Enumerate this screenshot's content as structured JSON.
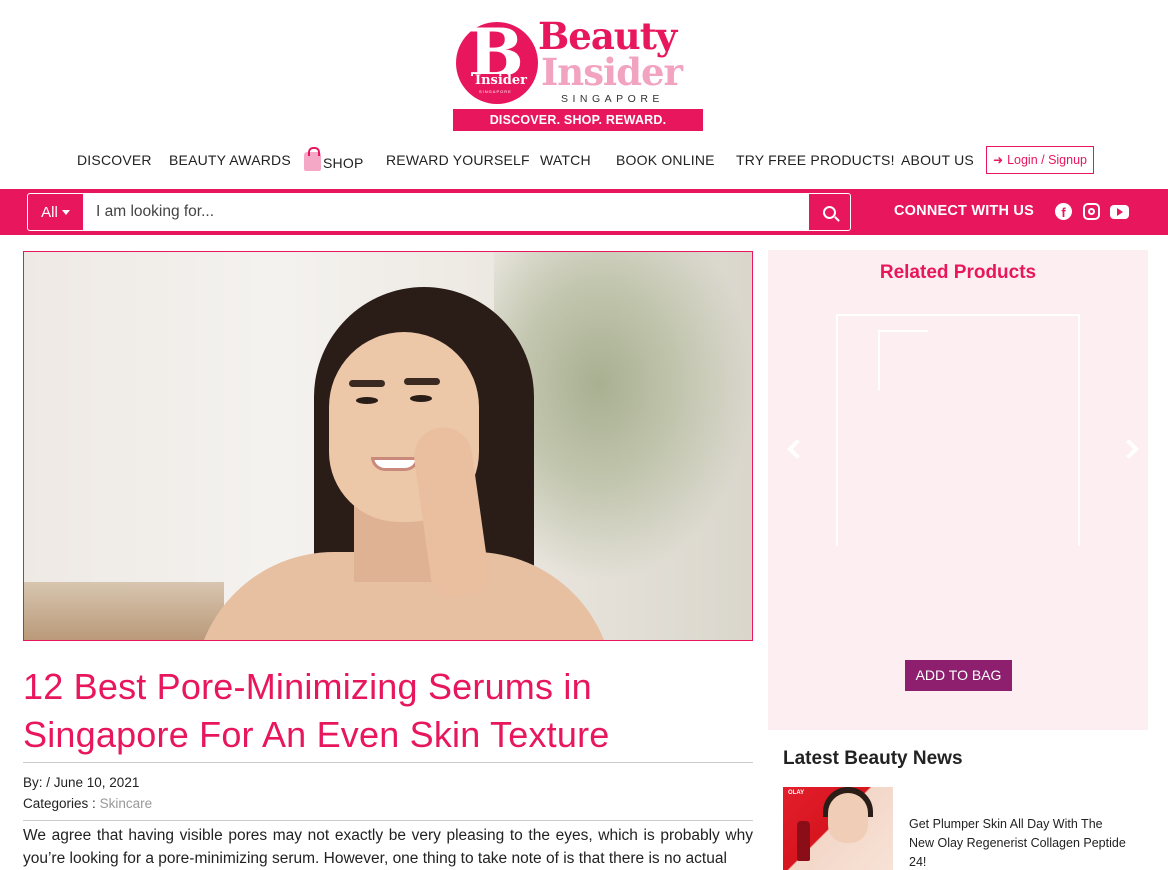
{
  "logo": {
    "letter": "B",
    "badge_word": "Insider",
    "badge_sub": "SINGAPORE",
    "word1": "Beauty",
    "word2": "Insider",
    "region": "SINGAPORE",
    "tagline": "DISCOVER. SHOP. REWARD."
  },
  "nav": {
    "items": [
      {
        "label": "DISCOVER"
      },
      {
        "label": "BEAUTY AWARDS"
      },
      {
        "label": "SHOP"
      },
      {
        "label": "REWARD YOURSELF"
      },
      {
        "label": "WATCH"
      },
      {
        "label": "BOOK ONLINE"
      },
      {
        "label": "TRY FREE PRODUCTS!"
      },
      {
        "label": "ABOUT US"
      }
    ],
    "login_label": "Login / Signup"
  },
  "search": {
    "category": "All",
    "placeholder": "I am looking for...",
    "connect_label": "CONNECT WITH US"
  },
  "icons": {
    "shop": "shopping-bag-icon",
    "login": "sign-in-icon",
    "dropdown": "caret-down-icon",
    "search": "search-icon",
    "facebook": "facebook-icon",
    "instagram": "instagram-icon",
    "youtube": "youtube-icon",
    "carousel_prev": "chevron-left-icon",
    "carousel_next": "chevron-right-icon"
  },
  "colors": {
    "brand": "#e8175d",
    "brand_light": "#f1a3bf",
    "add_button": "#8d1f6e",
    "related_bg": "#fdeef2"
  },
  "article": {
    "title": "12 Best Pore-Minimizing Serums in Singapore For An Even Skin Texture",
    "byline": "By: / June 10, 2021",
    "categories_label": "Categories :",
    "category": "Skincare",
    "body": "We agree that having visible pores may not exactly be very pleasing to the eyes, which is probably why you’re looking for a pore-minimizing serum. However, one thing to take note of is that there is no actual"
  },
  "related": {
    "title": "Related Products",
    "add_label": "ADD TO BAG"
  },
  "news": {
    "title": "Latest Beauty News",
    "items": [
      {
        "headline": "Get Plumper Skin All Day With The New Olay Regenerist Collagen Peptide 24!",
        "thumb_brand": "OLAY"
      }
    ]
  }
}
